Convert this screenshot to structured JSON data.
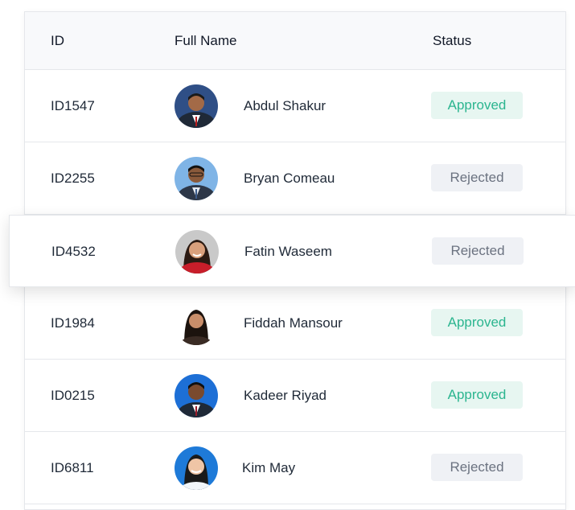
{
  "columns": {
    "id": "ID",
    "name": "Full Name",
    "status": "Status"
  },
  "colors": {
    "approved_bg": "#e7f6f1",
    "approved_text": "#2bb58f",
    "rejected_bg": "#eff1f5",
    "rejected_text": "#6b7280"
  },
  "rows": [
    {
      "id": "ID1547",
      "name": "Abdul Shakur",
      "status": "Approved",
      "avatar": "avatar-photo-icon"
    },
    {
      "id": "ID2255",
      "name": "Bryan Comeau",
      "status": "Rejected",
      "avatar": "avatar-photo-icon"
    },
    {
      "id": "ID4532",
      "name": "Fatin Waseem",
      "status": "Rejected",
      "avatar": "avatar-photo-icon"
    },
    {
      "id": "ID1984",
      "name": "Fiddah Mansour",
      "status": "Approved",
      "avatar": "avatar-photo-icon"
    },
    {
      "id": "ID0215",
      "name": "Kadeer Riyad",
      "status": "Approved",
      "avatar": "avatar-photo-icon"
    },
    {
      "id": "ID6811",
      "name": "Kim May",
      "status": "Rejected",
      "avatar": "avatar-photo-icon"
    }
  ]
}
